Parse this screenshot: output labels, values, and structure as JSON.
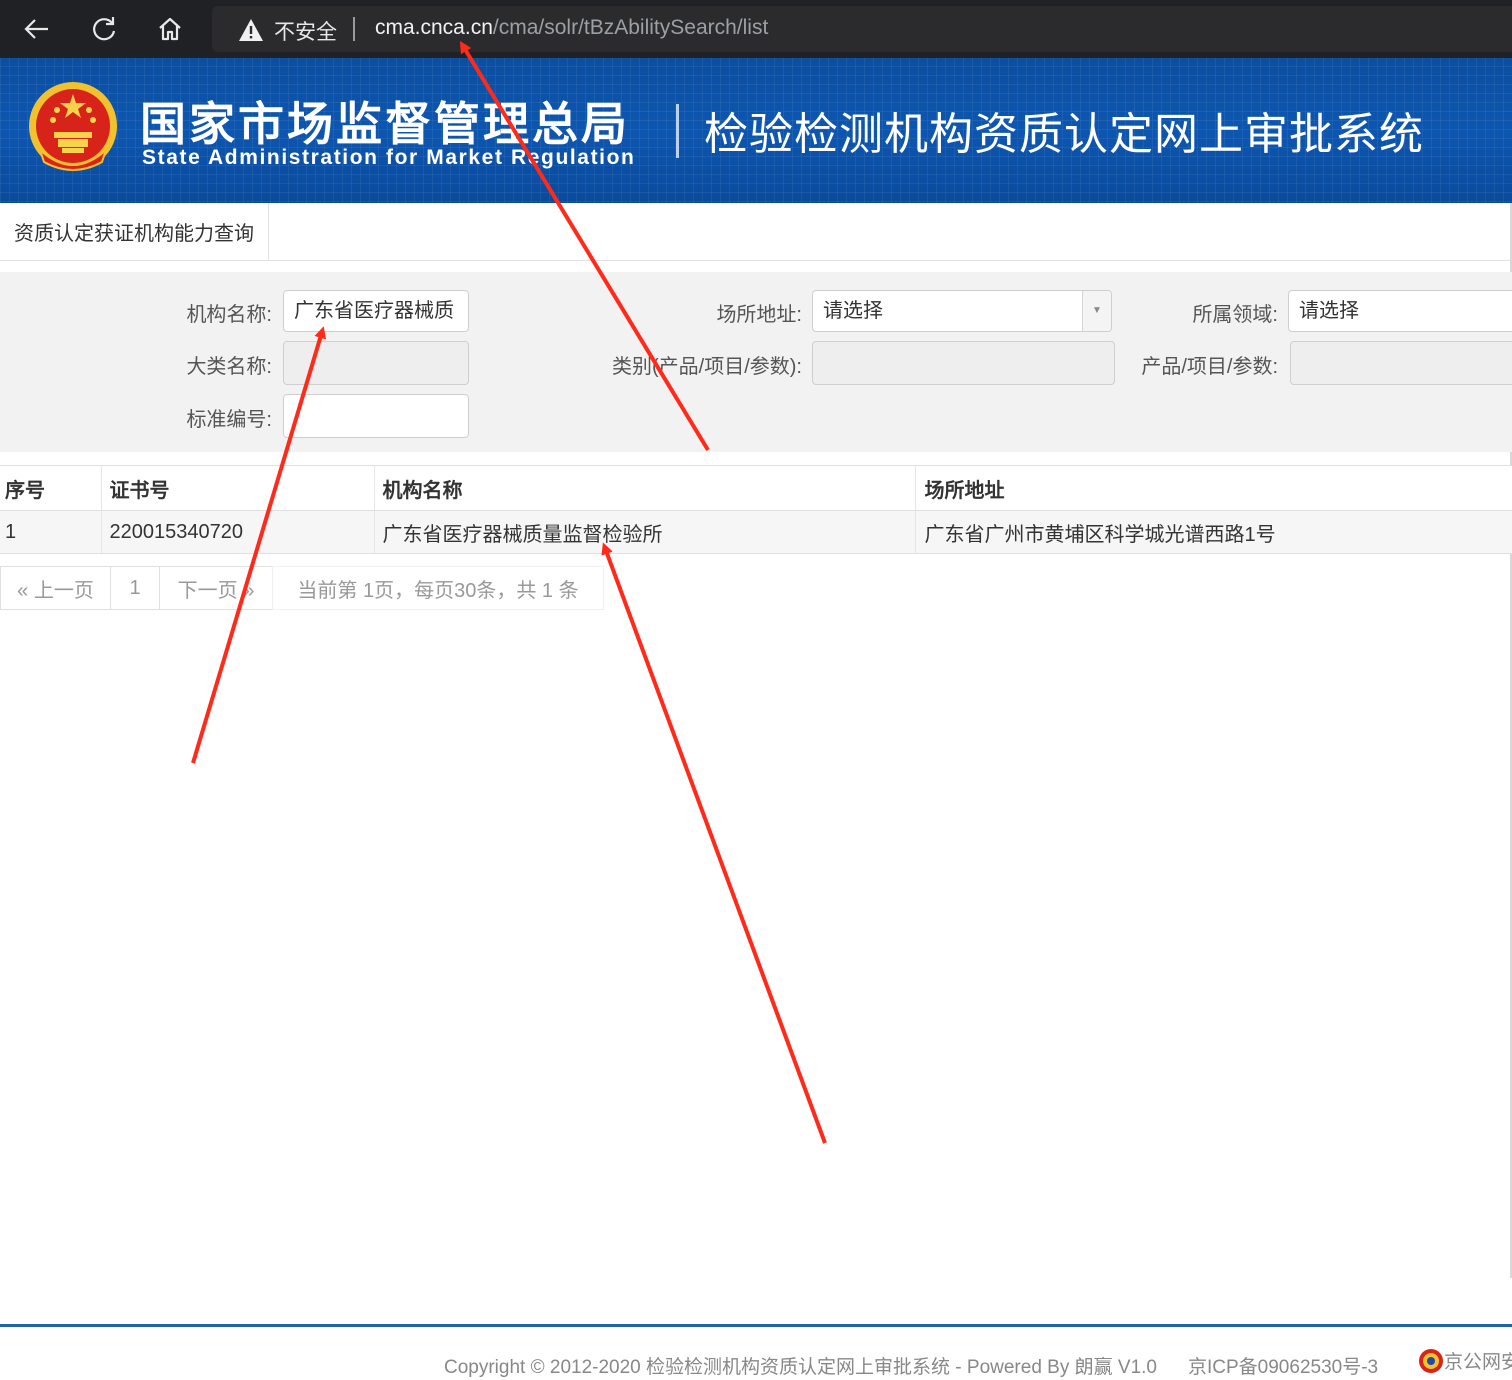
{
  "browser": {
    "security_label": "不安全",
    "url_host": "cma.cnca.cn",
    "url_path": "/cma/solr/tBzAbilitySearch/list"
  },
  "header": {
    "org_name_cn": "国家市场监督管理总局",
    "org_name_en": "State Administration  for  Market Regulation",
    "system_title": "检验检测机构资质认定网上审批系统"
  },
  "tab": {
    "label": "资质认定获证机构能力查询"
  },
  "form": {
    "org_name_label": "机构名称:",
    "org_name_value": "广东省医疗器械质",
    "site_address_label": "场所地址:",
    "site_address_value": "请选择",
    "field_label": "所属领域:",
    "field_value": "请选择",
    "major_category_label": "大类名称:",
    "category_label": "类别(产品/项目/参数):",
    "product_label": "产品/项目/参数:",
    "standard_no_label": "标准编号:"
  },
  "table": {
    "headers": [
      "序号",
      "证书号",
      "机构名称",
      "场所地址"
    ],
    "rows": [
      [
        "1",
        "220015340720",
        "广东省医疗器械质量监督检验所",
        "广东省广州市黄埔区科学城光谱西路1号"
      ]
    ]
  },
  "pagination": {
    "prev": "« 上一页",
    "page": "1",
    "next": "下一页 »",
    "info": "当前第 1页，每页30条，共 1 条"
  },
  "footer": {
    "copyright": "Copyright © 2012-2020 检验检测机构资质认定网上审批系统 - Powered By 朗赢 V1.0",
    "icp": "京ICP备09062530号-3",
    "police": "京公网安"
  },
  "colors": {
    "banner_blue": "#0d56b0",
    "annotation_red": "#ff2a1a",
    "footer_rule": "#1f63a8"
  }
}
